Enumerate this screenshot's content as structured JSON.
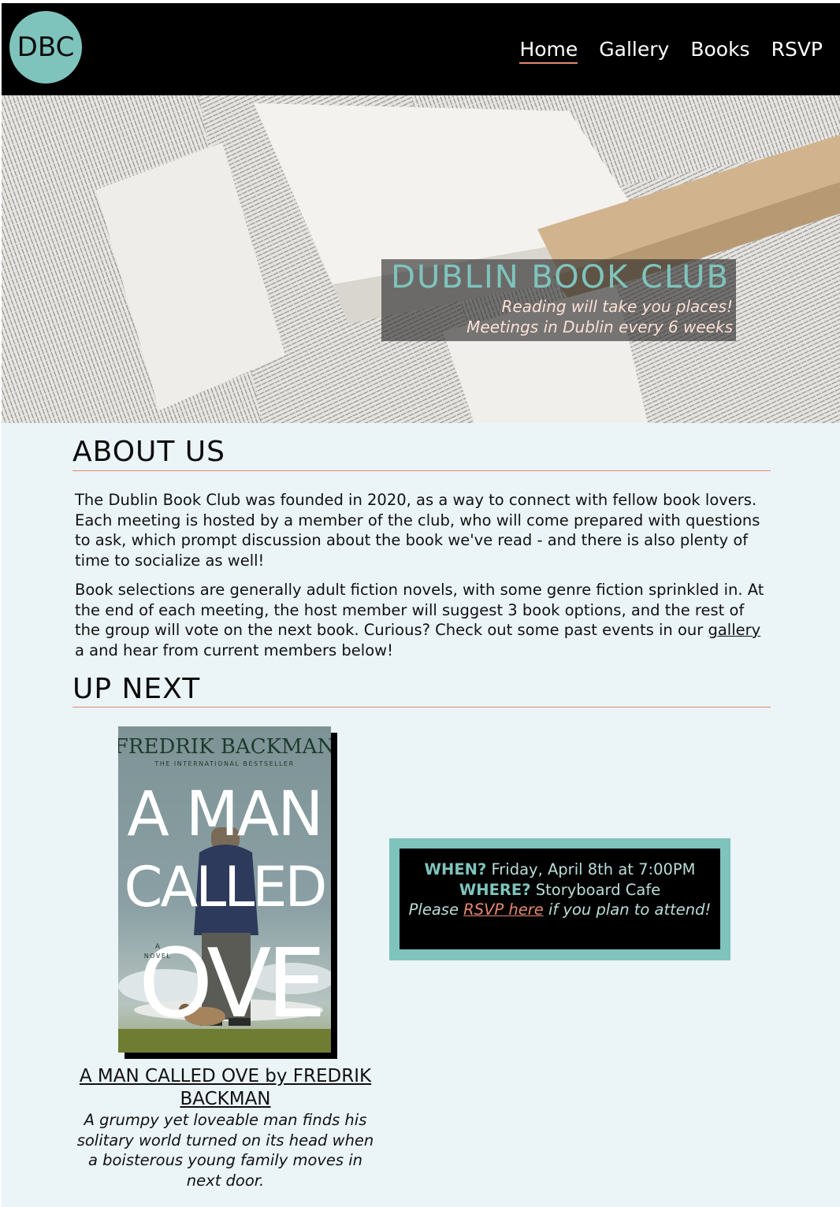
{
  "nav": {
    "logo_text": "DBC",
    "links": [
      {
        "label": "Home",
        "active": true
      },
      {
        "label": "Gallery",
        "active": false
      },
      {
        "label": "Books",
        "active": false
      },
      {
        "label": "RSVP",
        "active": false
      }
    ]
  },
  "hero": {
    "title": "DUBLIN BOOK CLUB",
    "tagline": "Reading will take you places!",
    "subtitle": "Meetings in Dublin every 6 weeks"
  },
  "about": {
    "heading": "ABOUT US",
    "para1": "The Dublin Book Club was founded in 2020, as a way to connect with fellow book lovers. Each meeting is hosted by a member of the club, who will come prepared with questions to ask, which prompt discussion about the book we've read - and there is also plenty of time to socialize as well!",
    "para2_before": "Book selections are generally adult fiction novels, with some genre fiction sprinkled in. At the end of each meeting, the host member will suggest 3 book options, and the rest of the group will vote on the next book. Curious? Check out some past events in our ",
    "para2_link": "gallery",
    "para2_after": " a and hear from current members below!"
  },
  "up_next": {
    "heading": "UP NEXT",
    "cover": {
      "author": "FREDRIK BACKMAN",
      "tagline": "THE INTERNATIONAL BESTSELLER",
      "title_lines": [
        "A MAN",
        "CALLED",
        "OVE"
      ],
      "novel_label_a": "A",
      "novel_label_b": "NOVEL"
    },
    "book_title": "A MAN CALLED OVE by FREDRIK BACKMAN",
    "book_desc": "A grumpy yet loveable man finds his solitary world turned on its head when a boisterous young family moves in next door."
  },
  "event": {
    "when_label": "WHEN?",
    "when_value": " Friday, April 8th at 7:00PM",
    "where_label": "WHERE?",
    "where_value": " Storyboard Cafe",
    "note_before": "Please ",
    "note_link": "RSVP here",
    "note_after": " if you plan to attend!"
  },
  "colors": {
    "teal": "#7ec4bd",
    "coral": "#e5886c",
    "page_bg": "#ebf4f7",
    "nav_bg": "#000000"
  }
}
